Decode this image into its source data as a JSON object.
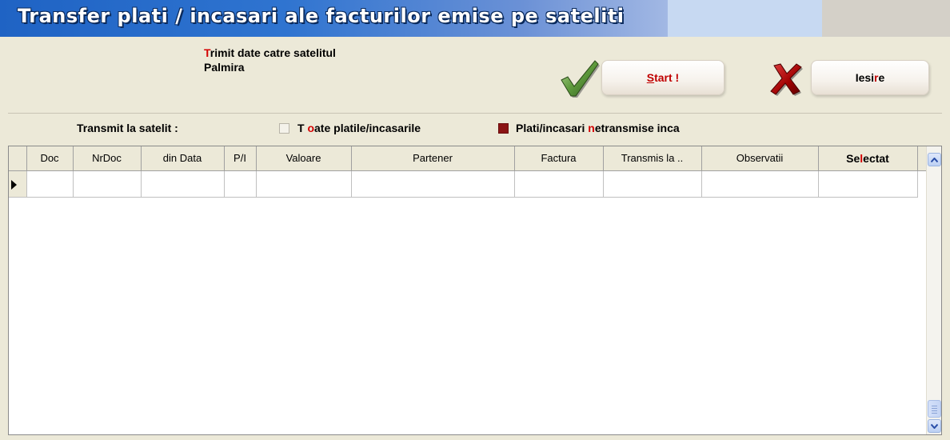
{
  "window": {
    "title": "Transfer plati / incasari ale facturilor emise pe sateliti"
  },
  "header": {
    "info_hot": "T",
    "info_rest": "rimit date catre satelitul",
    "satellite_name": "Palmira"
  },
  "buttons": {
    "start_hot": "S",
    "start_rest": "tart !",
    "exit_pre": "Iesi",
    "exit_hot": "r",
    "exit_post": "e"
  },
  "filter": {
    "label": "Transmit la satelit :",
    "option_all_pre": "T",
    "option_all_hot": "o",
    "option_all_post": "ate platile/incasarile",
    "option_all_checked": false,
    "option_pending_pre": "Plati/incasari ",
    "option_pending_hot": "n",
    "option_pending_post": "etransmise inca",
    "option_pending_checked": true
  },
  "grid": {
    "columns": [
      "Doc",
      "NrDoc",
      "din Data",
      "P/I",
      "Valoare",
      "Partener",
      "Factura",
      "Transmis la ..",
      "Observatii"
    ],
    "selected_col": {
      "pre": "Se",
      "hot": "l",
      "post": "ectat"
    },
    "rows": [
      [
        "",
        "",
        "",
        "",
        "",
        "",
        "",
        "",
        "",
        ""
      ]
    ]
  },
  "colors": {
    "accent_red": "#d40000",
    "title_blue": "#1f63c4",
    "window_bg": "#ece9d8"
  },
  "icons": [
    "check-icon",
    "close-x-icon",
    "row-pointer-icon",
    "scroll-up-icon",
    "scroll-down-icon"
  ]
}
